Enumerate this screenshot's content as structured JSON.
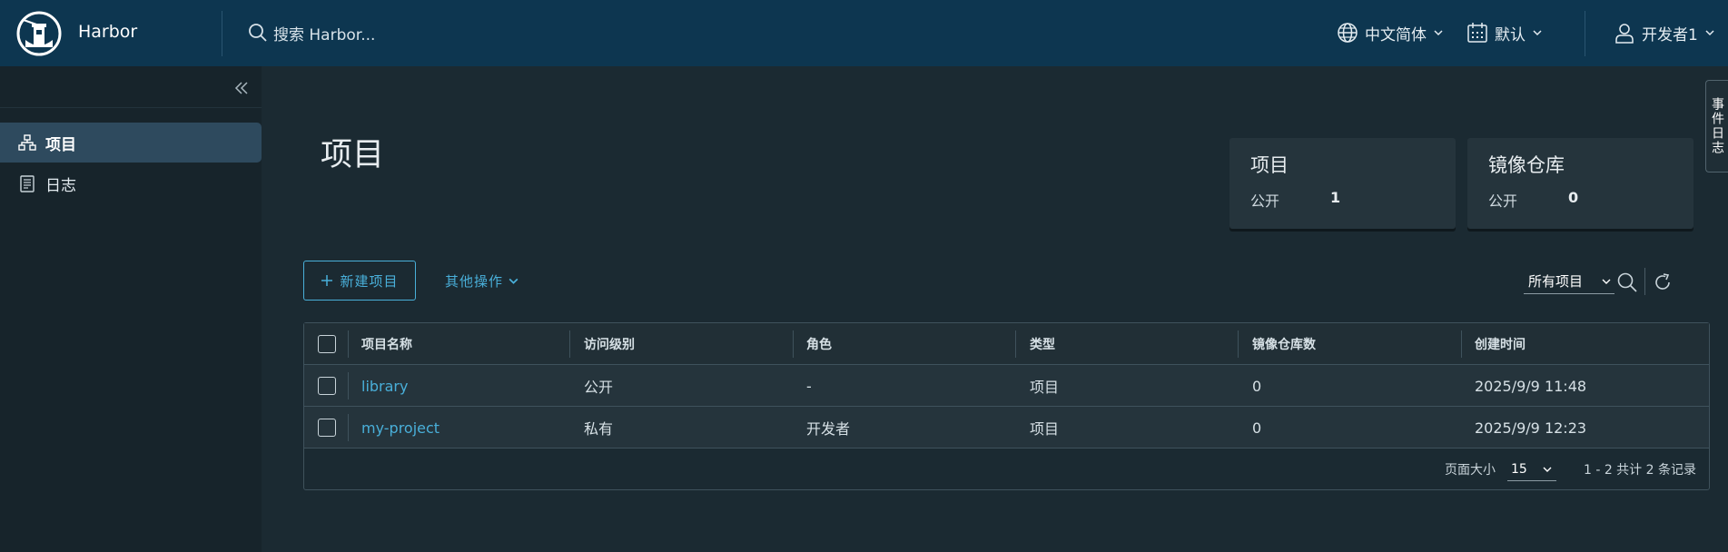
{
  "header": {
    "brand": "Harbor",
    "search_placeholder": "搜索 Harbor...",
    "language": "中文简体",
    "date_format": "默认",
    "user": "开发者1"
  },
  "sidebar": {
    "items": [
      {
        "label": "项目",
        "icon": "projects-icon",
        "active": true
      },
      {
        "label": "日志",
        "icon": "logs-icon",
        "active": false
      }
    ]
  },
  "event_log_tab": "事件日志",
  "page_title": "项目",
  "summary_cards": [
    {
      "title": "项目",
      "label": "公开",
      "value": "1"
    },
    {
      "title": "镜像仓库",
      "label": "公开",
      "value": "0"
    }
  ],
  "toolbar": {
    "new_project": "新建项目",
    "other_actions": "其他操作",
    "filter_value": "所有项目"
  },
  "table": {
    "columns": [
      "项目名称",
      "访问级别",
      "角色",
      "类型",
      "镜像仓库数",
      "创建时间"
    ],
    "rows": [
      [
        "library",
        "公开",
        "-",
        "项目",
        "0",
        "2025/9/9 11:48"
      ],
      [
        "my-project",
        "私有",
        "开发者",
        "项目",
        "0",
        "2025/9/9 12:23"
      ]
    ]
  },
  "pagination": {
    "page_size_label": "页面大小",
    "page_size": "15",
    "summary": "1 - 2 共计 2 条记录"
  },
  "colors": {
    "header_bg": "#0d3650",
    "body_bg": "#1b2a32",
    "sidebar_bg": "#17242b",
    "accent": "#49afd9",
    "active_nav": "#2e4a5e"
  }
}
